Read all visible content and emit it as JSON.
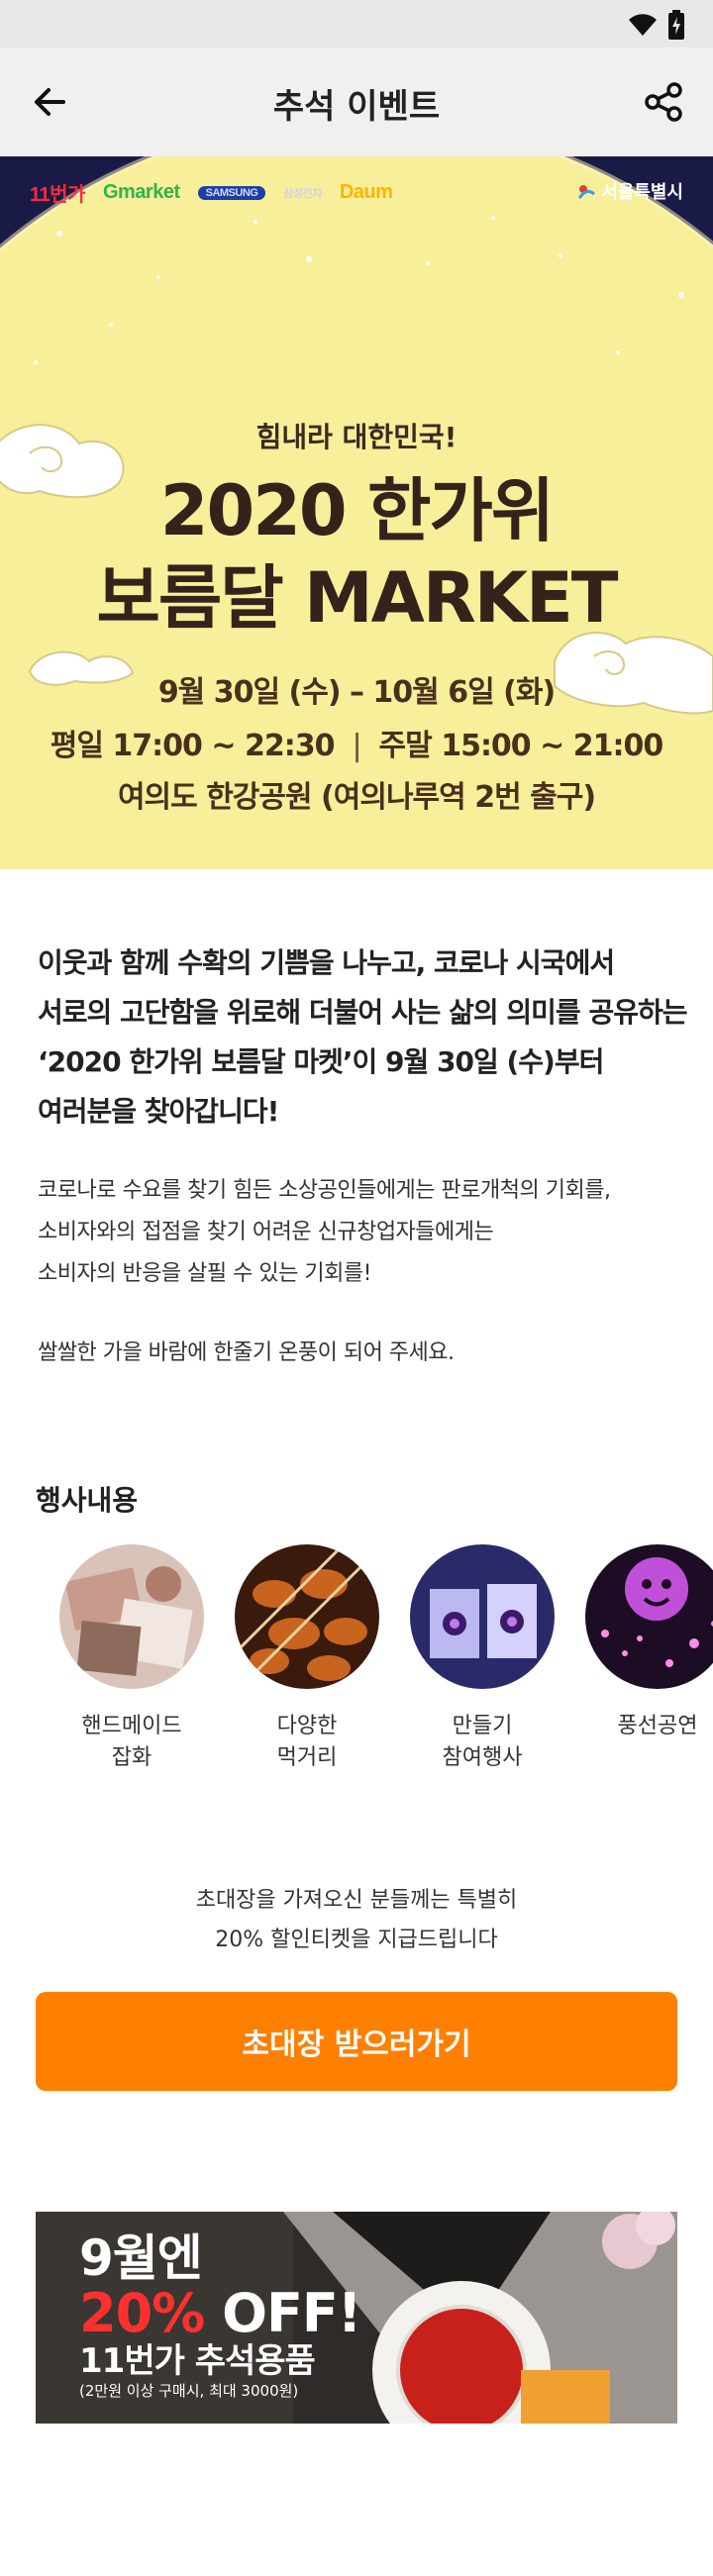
{
  "header": {
    "title": "추석 이벤트",
    "back_icon": "arrow-left-icon",
    "share_icon": "share-icon"
  },
  "hero": {
    "sponsors": [
      "11번가",
      "Gmarket",
      "SAMSUNG",
      "삼성전자",
      "Daum"
    ],
    "seoul": "서울특별시",
    "subtitle": "힘내라 대한민국!",
    "title_line1": "2020 한가위",
    "title_line2": "보름달 MARKET",
    "date": "9월 30일 (수) – 10월 6일 (화)",
    "weekday_time": "평일 17:00 ~ 22:30",
    "weekend_time": "주말 15:00 ~ 21:00",
    "place": "여의도 한강공원 (여의나루역 2번 출구)",
    "colors": {
      "night_sky": "#1a1a46",
      "moon": "#f7ef9a"
    }
  },
  "intro": {
    "line1": "이웃과 함께 수확의 기쁨을 나누고, 코로나 시국에서",
    "line2": "서로의 고단함을 위로해 더불어 사는 삶의 의미를 공유하는",
    "line3": "‘2020 한가위 보름달 마켓’이 9월 30일 (수)부터",
    "line4": "여러분을 찾아갑니다!"
  },
  "detail": {
    "line1": "코로나로 수요를 찾기 힘든 소상공인들에게는 판로개척의 기회를,",
    "line2": "소비자와의 접점을 찾기 어려운 신규창업자들에게는",
    "line3": "소비자의 반응을 살필 수 있는 기회를!",
    "line4": "쌀쌀한 가을 바람에 한줄기 온풍이 되어 주세요."
  },
  "events": {
    "title": "행사내용",
    "items": [
      {
        "label": "핸드메이드\n잡화"
      },
      {
        "label": "다양한\n먹거리"
      },
      {
        "label": "만들기\n참여행사"
      },
      {
        "label": "풍선공연"
      }
    ]
  },
  "invite": {
    "note_line1": "초대장을 가져오신 분들께는 특별히",
    "note_line2": "20% 할인티켓을 지급드립니다",
    "button_label": "초대장 받으러가기",
    "button_color": "#ff7f00"
  },
  "promo": {
    "line1": "9월엔",
    "line2_pct": "20%",
    "line2_rest": " OFF!",
    "line3": "11번가 추석용품",
    "line4": "(2만원 이상 구매시, 최대 3000원)"
  }
}
